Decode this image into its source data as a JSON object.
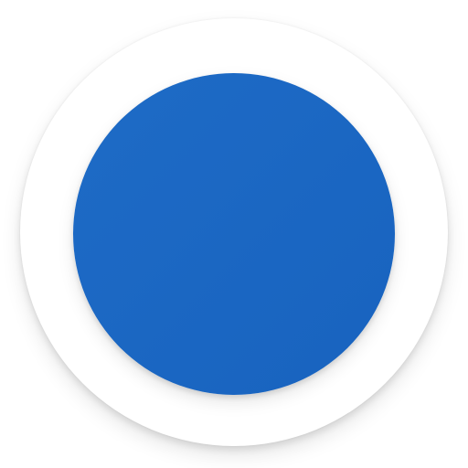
{
  "icon": {
    "semantic": "blue-circle-app-icon",
    "colors": {
      "outer_ring": "#ffffff",
      "inner_fill_start": "#1e6bc6",
      "inner_fill_end": "#1863bf"
    }
  }
}
